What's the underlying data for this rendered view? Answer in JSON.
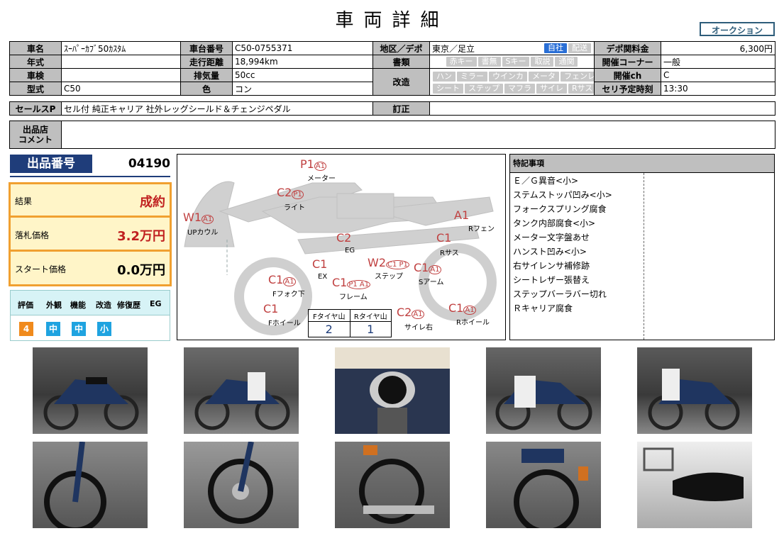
{
  "header": {
    "title": "車両詳細",
    "auction_button": "オークション"
  },
  "info": {
    "model_label": "車名",
    "model": "ｽｰﾊﾟｰｶﾌﾞ50ｶｽﾀﾑ",
    "frame_label": "車台番号",
    "frame": "C50-0755371",
    "region_label": "地区／デポ",
    "region": "東京／足立",
    "region_tags": [
      "自社",
      "配送"
    ],
    "fee_label": "デポ関料金",
    "fee": "6,300円",
    "year_label": "年式",
    "year": "",
    "mileage_label": "走行距離",
    "mileage": "18,994km",
    "docs_label": "書類",
    "docs_tags": [
      "赤キー",
      "書無",
      "Sキー",
      "取説",
      "通関"
    ],
    "corner_label": "開催コーナー",
    "corner": "一般",
    "inspection_label": "車検",
    "inspection": "",
    "displacement_label": "排気量",
    "displacement": "50cc",
    "modified_label": "改造",
    "mod_tags_row1": [
      "ハン",
      "ミラー",
      "ウインカ",
      "メータ",
      "フェンレス"
    ],
    "mod_tags_row2": [
      "シート",
      "ステップ",
      "マフラ",
      "サイレ",
      "Rサス"
    ],
    "ch_label": "開催ch",
    "ch": "C",
    "type_label": "型式",
    "type": "C50",
    "color_label": "色",
    "color": "コン",
    "time_label": "セリ予定時刻",
    "time": "13:30",
    "sales_label": "セールスP",
    "sales": "セル付 純正キャリア 社外レッグシールド＆チェンジペダル",
    "correction_label": "訂正",
    "correction": "",
    "comment_label1": "出品店",
    "comment_label2": "コメント",
    "comment": ""
  },
  "lot": {
    "label": "出品番号",
    "number": "04190",
    "result_label": "結果",
    "result": "成約",
    "price_label": "落札価格",
    "price": "3.2万円",
    "start_label": "スタート価格",
    "start": "0.0万円"
  },
  "grades": {
    "headers": [
      "評価",
      "外観",
      "機能",
      "改造",
      "修復歴",
      "EG"
    ],
    "values": [
      "4",
      "中",
      "中",
      "小"
    ],
    "colors": [
      "#f08a1c",
      "#1fa3e0",
      "#1fa3e0",
      "#1fa3e0"
    ]
  },
  "diagram": {
    "marks": [
      {
        "code": "P1",
        "sub": "A1",
        "label": "メーター"
      },
      {
        "code": "C2",
        "sub": "P1",
        "label": "ライト"
      },
      {
        "code": "W1",
        "sub": "A1",
        "label": "UPカウル"
      },
      {
        "code": "A1",
        "sub": "",
        "label": "Rフェン"
      },
      {
        "code": "C2",
        "sub": "",
        "label": "EG"
      },
      {
        "code": "C1",
        "sub": "",
        "label": "Rサス"
      },
      {
        "code": "C1",
        "sub": "",
        "label": "EX"
      },
      {
        "code": "W2",
        "sub": "C1 P1",
        "label": "ステップ"
      },
      {
        "code": "C1",
        "sub": "A1",
        "label": "Sアーム"
      },
      {
        "code": "C1",
        "sub": "A1",
        "label": "Fフォク下"
      },
      {
        "code": "C1",
        "sub": "P1 A1",
        "label": "フレーム"
      },
      {
        "code": "C1",
        "sub": "",
        "label": "Fホイール"
      },
      {
        "code": "C2",
        "sub": "A1",
        "label": "サイレ右"
      },
      {
        "code": "C1",
        "sub": "A1",
        "label": "Rホイール"
      }
    ],
    "tyre": {
      "front_label": "Fタイヤ山",
      "rear_label": "Rタイヤ山",
      "front": "2",
      "rear": "1"
    }
  },
  "notes": {
    "header": "特記事項",
    "items": [
      "Ｅ／Ｇ異音<小>",
      "ステムストッパ凹み<小>",
      "フォークスプリング腐食",
      "タンク内部腐食<小>",
      "メーター文字盤あせ",
      "ハンスト凹み<小>",
      "右サイレンサ補修跡",
      "シートレザー張替え",
      "ステップバーラバー切れ",
      "Ｒキャリア腐食"
    ]
  }
}
